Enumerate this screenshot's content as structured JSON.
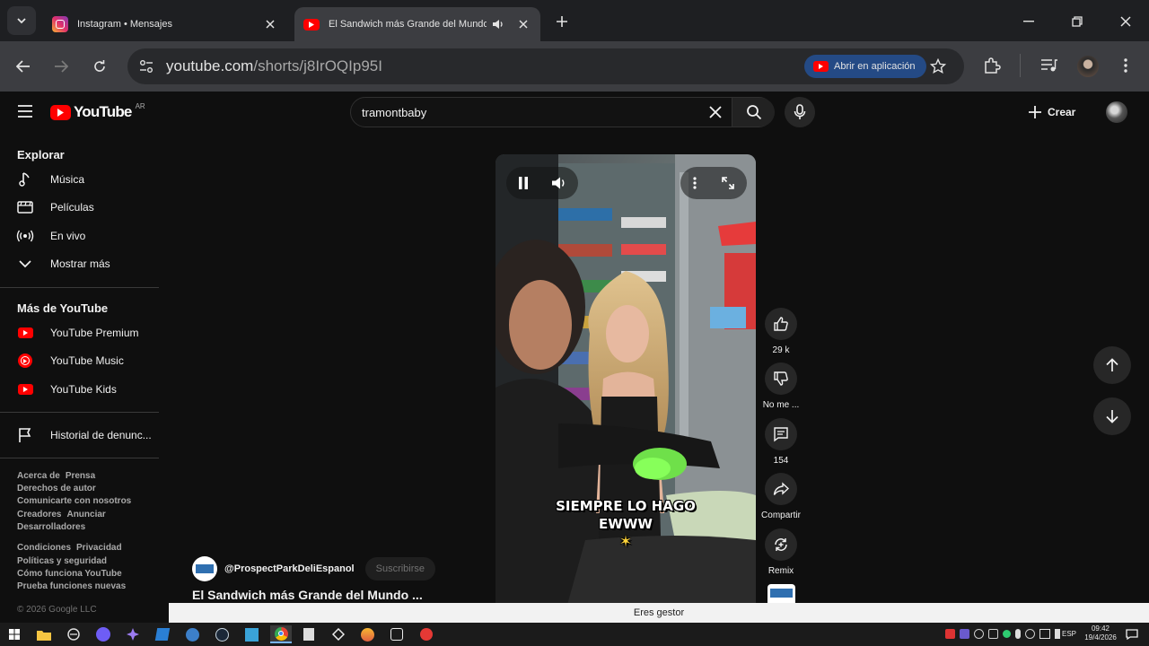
{
  "browser": {
    "tabs": [
      {
        "title": "Instagram • Mensajes",
        "favicon": "instagram-icon",
        "active": false
      },
      {
        "title": "El Sandwich más Grande del Mundo #prospect",
        "favicon": "youtube-icon",
        "active": true
      }
    ],
    "url_host": "youtube.com",
    "url_path": "/shorts/j8IrOQIp95I",
    "open_in_app_label": "Abrir en aplicación"
  },
  "youtube": {
    "logo_text": "YouTube",
    "region": "AR",
    "search_query": "tramontbaby",
    "create_label": "Crear",
    "sidebar": {
      "explore_title": "Explorar",
      "explore_items": [
        {
          "label": "Música",
          "icon": "music-note-icon"
        },
        {
          "label": "Películas",
          "icon": "film-icon"
        },
        {
          "label": "En vivo",
          "icon": "live-icon"
        },
        {
          "label": "Mostrar más",
          "icon": "chevron-down-icon"
        }
      ],
      "more_title": "Más de YouTube",
      "more_items": [
        {
          "label": "YouTube Premium",
          "icon": "youtube-premium-icon"
        },
        {
          "label": "YouTube Music",
          "icon": "youtube-music-icon"
        },
        {
          "label": "YouTube Kids",
          "icon": "youtube-kids-icon"
        }
      ],
      "report_history": "Historial de denunc...",
      "footer_links_1": [
        [
          "Acerca de",
          "Prensa"
        ],
        [
          "Derechos de autor"
        ],
        [
          "Comunicarte con nosotros"
        ],
        [
          "Creadores",
          "Anunciar"
        ],
        [
          "Desarrolladores"
        ]
      ],
      "footer_links_2": [
        [
          "Condiciones",
          "Privacidad"
        ],
        [
          "Políticas y seguridad"
        ],
        [
          "Cómo funciona YouTube"
        ],
        [
          "Prueba funciones nuevas"
        ]
      ],
      "copyright": "© 2026 Google LLC"
    },
    "short": {
      "caption_line1": "SIEMPRE LO HAGO",
      "caption_line2": "EWWW",
      "likes": "29 k",
      "dislike_label": "No me ...",
      "comments": "154",
      "share_label": "Compartir",
      "remix_label": "Remix",
      "channel": "@ProspectParkDeliEspanol",
      "subscribe_label": "Suscribirse",
      "title": "El Sandwich más Grande del Mundo ..."
    }
  },
  "toast": "Eres gestor",
  "taskbar": {
    "language": "ESP",
    "time": "09:42",
    "date": "19/4/2026"
  }
}
